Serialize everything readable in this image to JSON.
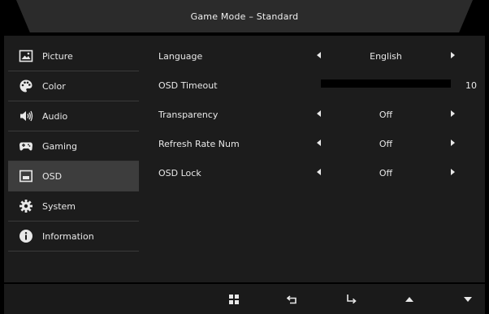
{
  "header": {
    "title": "Game Mode – Standard"
  },
  "sidebar": {
    "items": [
      {
        "label": "Picture",
        "icon": "picture-icon"
      },
      {
        "label": "Color",
        "icon": "palette-icon"
      },
      {
        "label": "Audio",
        "icon": "speaker-icon"
      },
      {
        "label": "Gaming",
        "icon": "gamepad-icon"
      },
      {
        "label": "OSD",
        "icon": "osd-icon",
        "active": true
      },
      {
        "label": "System",
        "icon": "gear-icon"
      },
      {
        "label": "Information",
        "icon": "info-icon"
      }
    ]
  },
  "settings": {
    "language": {
      "label": "Language",
      "value": "English"
    },
    "osd_timeout": {
      "label": "OSD Timeout",
      "value": "10"
    },
    "transparency": {
      "label": "Transparency",
      "value": "Off"
    },
    "refresh_rate_num": {
      "label": "Refresh Rate Num",
      "value": "Off"
    },
    "osd_lock": {
      "label": "OSD Lock",
      "value": "Off"
    }
  },
  "bottom_bar": {
    "buttons": [
      "menu-grid-icon",
      "back-icon",
      "enter-icon",
      "up-arrow-icon",
      "down-arrow-icon"
    ]
  },
  "colors": {
    "panel": "#1c1c1c",
    "active": "#3d3d3d",
    "text": "#e8e8e8"
  }
}
